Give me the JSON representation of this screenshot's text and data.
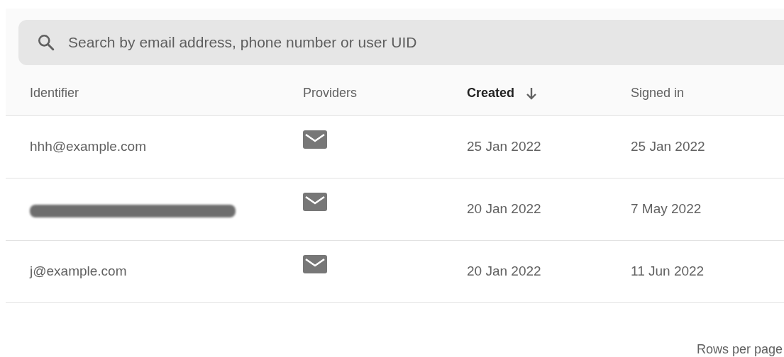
{
  "search": {
    "placeholder": "Search by email address, phone number or user UID"
  },
  "table": {
    "columns": [
      {
        "label": "Identifier",
        "sorted": false
      },
      {
        "label": "Providers",
        "sorted": false
      },
      {
        "label": "Created",
        "sorted": true
      },
      {
        "label": "Signed in",
        "sorted": false
      }
    ],
    "rows": [
      {
        "identifier": {
          "kind": "text",
          "text": "hhh@example.com"
        },
        "providers": [
          {
            "kind": "email"
          }
        ],
        "created": "25 Jan 2022",
        "signed_in": "25 Jan 2022"
      },
      {
        "identifier": {
          "kind": "redacted"
        },
        "providers": [
          {
            "kind": "email"
          }
        ],
        "created": "20 Jan 2022",
        "signed_in": "7 May 2022"
      },
      {
        "identifier": {
          "kind": "text",
          "text": "j@example.com"
        },
        "providers": [
          {
            "kind": "email"
          }
        ],
        "created": "20 Jan 2022",
        "signed_in": "11 Jun 2022"
      }
    ]
  },
  "footer": {
    "rows_per_page_label": "Rows per page"
  }
}
